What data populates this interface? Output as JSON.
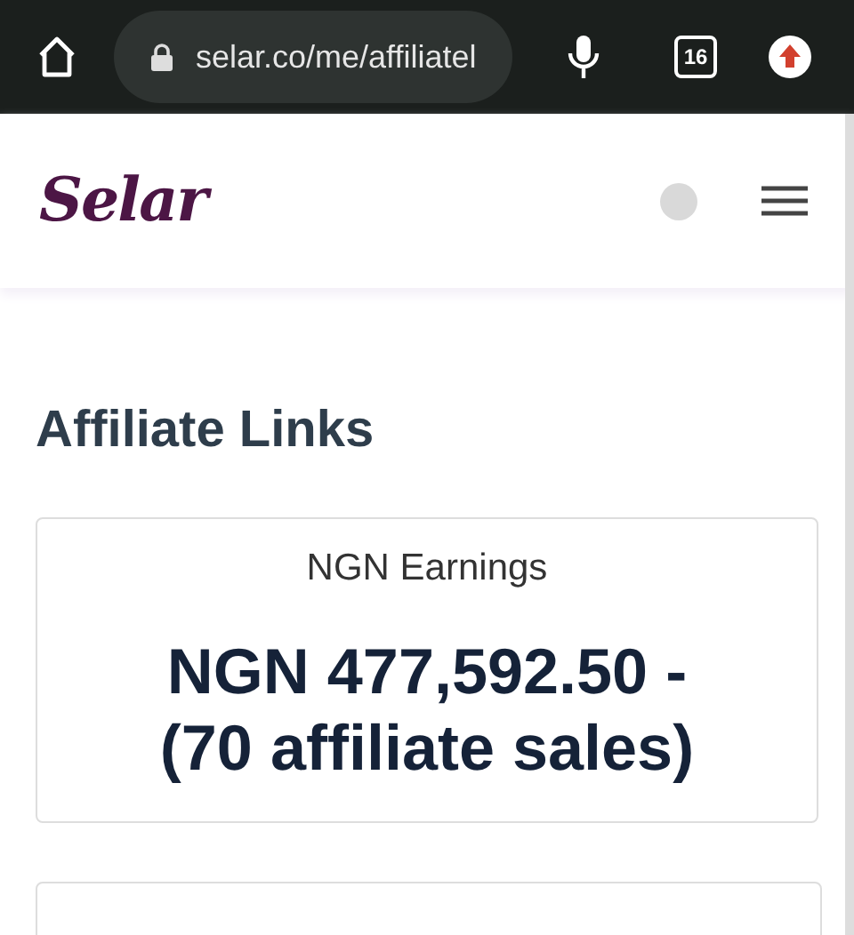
{
  "browser": {
    "url": "selar.co/me/affiliatel",
    "tab_count": "16"
  },
  "header": {
    "logo": "Selar"
  },
  "page": {
    "title": "Affiliate Links"
  },
  "earnings_card": {
    "label": "NGN Earnings",
    "amount": "NGN 477,592.50 - (70 affiliate sales)"
  }
}
